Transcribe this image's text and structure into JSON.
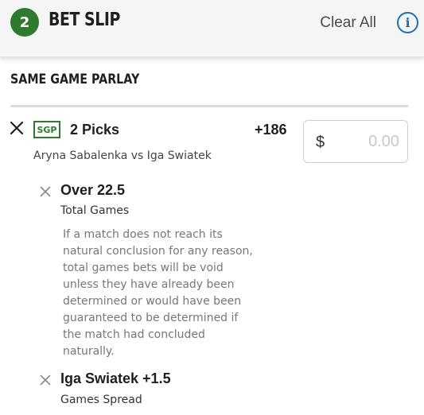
{
  "header": {
    "count": "2",
    "title": "BET SLIP",
    "clear_all": "Clear All",
    "info_glyph": "i"
  },
  "section": {
    "title": "SAME GAME PARLAY"
  },
  "parlay": {
    "badge": "SGP",
    "picks": "2 Picks",
    "odds": "+186",
    "matchup": "Aryna Sabalenka vs Iga Swiatek",
    "wager": {
      "currency": "$",
      "placeholder": "0.00"
    },
    "legs": [
      {
        "title": "Over 22.5",
        "market": "Total Games",
        "description": "If a match does not reach its natural conclusion for any reason, total games bets will be void unless they have already been determined or would have been guaranteed to be determined if the match had concluded naturally."
      },
      {
        "title": "Iga Swiatek +1.5",
        "market": "Games Spread"
      }
    ]
  },
  "colors": {
    "brand_green": "#2f7a2f",
    "info_blue": "#1f6fb5"
  },
  "icons": [
    "close-icon",
    "info-icon",
    "remove-leg-icon"
  ]
}
